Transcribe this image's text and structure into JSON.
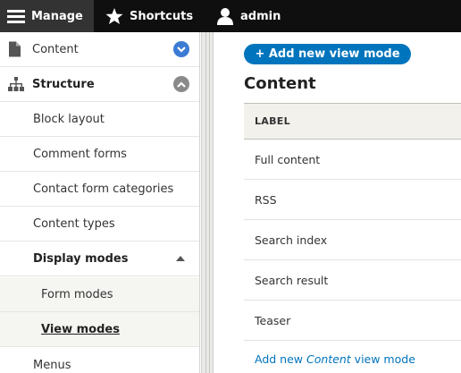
{
  "toolbar": {
    "manage": "Manage",
    "shortcuts": "Shortcuts",
    "admin": "admin"
  },
  "sidebar": {
    "items": [
      {
        "label": "Content",
        "icon": "file-icon",
        "toggle": "chevron-down"
      },
      {
        "label": "Structure",
        "icon": "sitemap-icon",
        "toggle": "chevron-up"
      },
      {
        "label": "Block layout"
      },
      {
        "label": "Comment forms"
      },
      {
        "label": "Contact form categories"
      },
      {
        "label": "Content types"
      },
      {
        "label": "Display modes"
      },
      {
        "label": "Form modes"
      },
      {
        "label": "View modes"
      },
      {
        "label": "Menus"
      }
    ]
  },
  "main": {
    "add_button": "+ Add new view mode",
    "title": "Content",
    "table": {
      "header": "LABEL",
      "rows": [
        "Full content",
        "RSS",
        "Search index",
        "Search result",
        "Teaser"
      ]
    },
    "add_link": {
      "prefix": "Add new ",
      "entity": "Content",
      "suffix": " view mode"
    }
  },
  "colors": {
    "toolbar_bg": "#0f0f0f",
    "accent": "#0074bd",
    "toggle_blue": "#3b7bd4",
    "toggle_grey": "#8a8a8a"
  }
}
